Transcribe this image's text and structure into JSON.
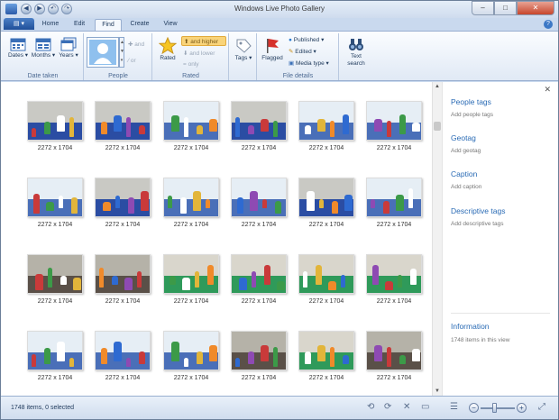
{
  "window": {
    "title": "Windows Live Photo Gallery",
    "minimize": "–",
    "maximize": "□",
    "close": "✕"
  },
  "quick_access": {
    "back": "◀",
    "forward": "▶",
    "undo": "↶",
    "redo": "↷"
  },
  "menu": {
    "file_button": "▤ ▾",
    "tabs": [
      "Home",
      "Edit",
      "Find",
      "Create",
      "View"
    ],
    "active_tab": "Find",
    "help": "?"
  },
  "ribbon": {
    "groups": {
      "date_taken": {
        "label": "Date taken",
        "buttons": [
          {
            "label": "Dates ▾",
            "icon": "calendar-icon"
          },
          {
            "label": "Months ▾",
            "icon": "calendar-icon"
          },
          {
            "label": "Years ▾",
            "icon": "calendar-stack-icon"
          }
        ]
      },
      "people": {
        "label": "People",
        "and": "and",
        "or": "or"
      },
      "rated": {
        "label": "Rated",
        "rated_button": "Rated",
        "and_higher": "and higher",
        "and_lower": "and lower",
        "only": "only"
      },
      "tags": {
        "label": "Tags ▾"
      },
      "file_details": {
        "label": "File details",
        "flagged": "Flagged",
        "published": "Published ▾",
        "edited": "Edited ▾",
        "media_type": "Media type ▾"
      },
      "text_search": {
        "label_line1": "Text",
        "label_line2": "search"
      }
    }
  },
  "gallery": {
    "dimension_label": "2272 x 1704",
    "rows": [
      {
        "captions": [
          "2272 x 1704",
          "2272 x 1704",
          "2272 x 1704",
          "2272 x 1704",
          "2272 x 1704",
          "2272 x 1704"
        ]
      },
      {
        "captions": [
          "2272 x 1704",
          "2272 x 1704",
          "2272 x 1704",
          "2272 x 1704",
          "2272 x 1704",
          "2272 x 1704"
        ]
      },
      {
        "captions": [
          "2272 x 1704",
          "2272 x 1704",
          "2272 x 1704",
          "2272 x 1704",
          "2272 x 1704",
          "2272 x 1704"
        ]
      },
      {
        "captions": [
          "2272 x 1704",
          "2272 x 1704",
          "2272 x 1704",
          "2272 x 1704",
          "2272 x 1704",
          "2272 x 1704"
        ]
      }
    ],
    "themes": {
      "classroom_blue": {
        "wall": "#c9c9c4",
        "floor": "#2b4da3"
      },
      "classroom_bright": {
        "wall": "#e6eef5",
        "floor": "#4a6fb8"
      },
      "science_green": {
        "wall": "#d9d6cc",
        "floor": "#2f9a5a"
      },
      "hall": {
        "wall": "#b5b2a8",
        "floor": "#5a5048"
      }
    }
  },
  "info_pane": {
    "close": "✕",
    "people_tags": {
      "title": "People tags",
      "action": "Add people tags"
    },
    "geotag": {
      "title": "Geotag",
      "action": "Add geotag"
    },
    "caption": {
      "title": "Caption",
      "action": "Add caption"
    },
    "descriptive_tags": {
      "title": "Descriptive tags",
      "action": "Add descriptive tags"
    },
    "information": {
      "title": "Information",
      "detail": "1748 items in this view"
    }
  },
  "status": {
    "text": "1748 items, 0 selected",
    "zoom_minus": "−",
    "zoom_plus": "+",
    "zoom_level": 0.42
  }
}
